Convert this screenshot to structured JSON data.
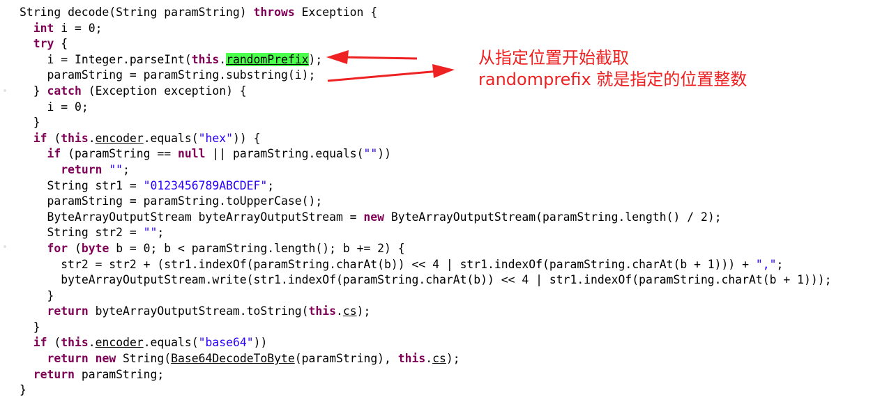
{
  "code_lines": [
    {
      "indent": 0,
      "tokens": [
        {
          "t": "String decode(String paramString) "
        },
        {
          "t": "throws",
          "c": "kw"
        },
        {
          "t": " Exception {"
        }
      ]
    },
    {
      "indent": 1,
      "tokens": [
        {
          "t": "int",
          "c": "kw"
        },
        {
          "t": " i = 0;"
        }
      ]
    },
    {
      "indent": 1,
      "tokens": [
        {
          "t": "try",
          "c": "kw"
        },
        {
          "t": " {"
        }
      ]
    },
    {
      "indent": 2,
      "tokens": [
        {
          "t": "i = Integer.parseInt("
        },
        {
          "t": "this",
          "c": "kw"
        },
        {
          "t": "."
        },
        {
          "t": "randomPrefix",
          "c": "hl"
        },
        {
          "t": ");"
        }
      ]
    },
    {
      "indent": 2,
      "tokens": [
        {
          "t": "paramString = paramString.substring(i);"
        }
      ]
    },
    {
      "indent": 1,
      "tokens": [
        {
          "t": "} "
        },
        {
          "t": "catch",
          "c": "kw"
        },
        {
          "t": " (Exception exception) {"
        }
      ]
    },
    {
      "indent": 2,
      "tokens": [
        {
          "t": "i = 0;"
        }
      ]
    },
    {
      "indent": 1,
      "tokens": [
        {
          "t": "}"
        }
      ]
    },
    {
      "indent": 1,
      "tokens": [
        {
          "t": "if",
          "c": "kw"
        },
        {
          "t": " ("
        },
        {
          "t": "this",
          "c": "kw"
        },
        {
          "t": "."
        },
        {
          "t": "encoder",
          "c": "ul"
        },
        {
          "t": ".equals("
        },
        {
          "t": "\"hex\"",
          "c": "str"
        },
        {
          "t": ")) {"
        }
      ]
    },
    {
      "indent": 2,
      "tokens": [
        {
          "t": "if",
          "c": "kw"
        },
        {
          "t": " (paramString == "
        },
        {
          "t": "null",
          "c": "kw"
        },
        {
          "t": " || paramString.equals("
        },
        {
          "t": "\"\"",
          "c": "str"
        },
        {
          "t": "))"
        }
      ]
    },
    {
      "indent": 3,
      "tokens": [
        {
          "t": "return",
          "c": "kw"
        },
        {
          "t": " "
        },
        {
          "t": "\"\"",
          "c": "str"
        },
        {
          "t": ";"
        }
      ]
    },
    {
      "indent": 2,
      "tokens": [
        {
          "t": "String str1 = "
        },
        {
          "t": "\"0123456789ABCDEF\"",
          "c": "str"
        },
        {
          "t": ";"
        }
      ]
    },
    {
      "indent": 2,
      "tokens": [
        {
          "t": "paramString = paramString.toUpperCase();"
        }
      ]
    },
    {
      "indent": 2,
      "tokens": [
        {
          "t": "ByteArrayOutputStream byteArrayOutputStream = "
        },
        {
          "t": "new",
          "c": "kw"
        },
        {
          "t": " ByteArrayOutputStream(paramString.length() / 2);"
        }
      ]
    },
    {
      "indent": 2,
      "tokens": [
        {
          "t": "String str2 = "
        },
        {
          "t": "\"\"",
          "c": "str"
        },
        {
          "t": ";"
        }
      ]
    },
    {
      "indent": 2,
      "tokens": [
        {
          "t": "for",
          "c": "kw"
        },
        {
          "t": " ("
        },
        {
          "t": "byte",
          "c": "kw"
        },
        {
          "t": " b = 0; b < paramString.length(); b += 2) {"
        }
      ]
    },
    {
      "indent": 3,
      "tokens": [
        {
          "t": "str2 = str2 + (str1.indexOf(paramString.charAt(b)) << 4 | str1.indexOf(paramString.charAt(b + 1))) + "
        },
        {
          "t": "\",\"",
          "c": "str"
        },
        {
          "t": ";"
        }
      ]
    },
    {
      "indent": 3,
      "tokens": [
        {
          "t": "byteArrayOutputStream.write(str1.indexOf(paramString.charAt(b)) << 4 | str1.indexOf(paramString.charAt(b + 1)));"
        }
      ]
    },
    {
      "indent": 2,
      "tokens": [
        {
          "t": "}"
        }
      ]
    },
    {
      "indent": 2,
      "tokens": [
        {
          "t": "return",
          "c": "kw"
        },
        {
          "t": " byteArrayOutputStream.toString("
        },
        {
          "t": "this",
          "c": "kw"
        },
        {
          "t": "."
        },
        {
          "t": "cs",
          "c": "ul"
        },
        {
          "t": ");"
        }
      ]
    },
    {
      "indent": 1,
      "tokens": [
        {
          "t": "}"
        }
      ]
    },
    {
      "indent": 1,
      "tokens": [
        {
          "t": "if",
          "c": "kw"
        },
        {
          "t": " ("
        },
        {
          "t": "this",
          "c": "kw"
        },
        {
          "t": "."
        },
        {
          "t": "encoder",
          "c": "ul"
        },
        {
          "t": ".equals("
        },
        {
          "t": "\"base64\"",
          "c": "str"
        },
        {
          "t": "))"
        }
      ]
    },
    {
      "indent": 2,
      "tokens": [
        {
          "t": "return",
          "c": "kw"
        },
        {
          "t": " "
        },
        {
          "t": "new",
          "c": "kw"
        },
        {
          "t": " String("
        },
        {
          "t": "Base64DecodeToByte",
          "c": "ul"
        },
        {
          "t": "(paramString), "
        },
        {
          "t": "this",
          "c": "kw"
        },
        {
          "t": "."
        },
        {
          "t": "cs",
          "c": "ul"
        },
        {
          "t": ");"
        }
      ]
    },
    {
      "indent": 1,
      "tokens": [
        {
          "t": "return",
          "c": "kw"
        },
        {
          "t": " paramString;"
        }
      ]
    },
    {
      "indent": 0,
      "tokens": [
        {
          "t": "}"
        }
      ]
    }
  ],
  "annotation": {
    "line1": "从指定位置开始截取",
    "line2": "randomprefix 就是指定的位置整数"
  },
  "colors": {
    "keyword": "#7f0055",
    "string": "#2a00ff",
    "highlight": "#4cff4c",
    "annotation": "#ee2222"
  }
}
